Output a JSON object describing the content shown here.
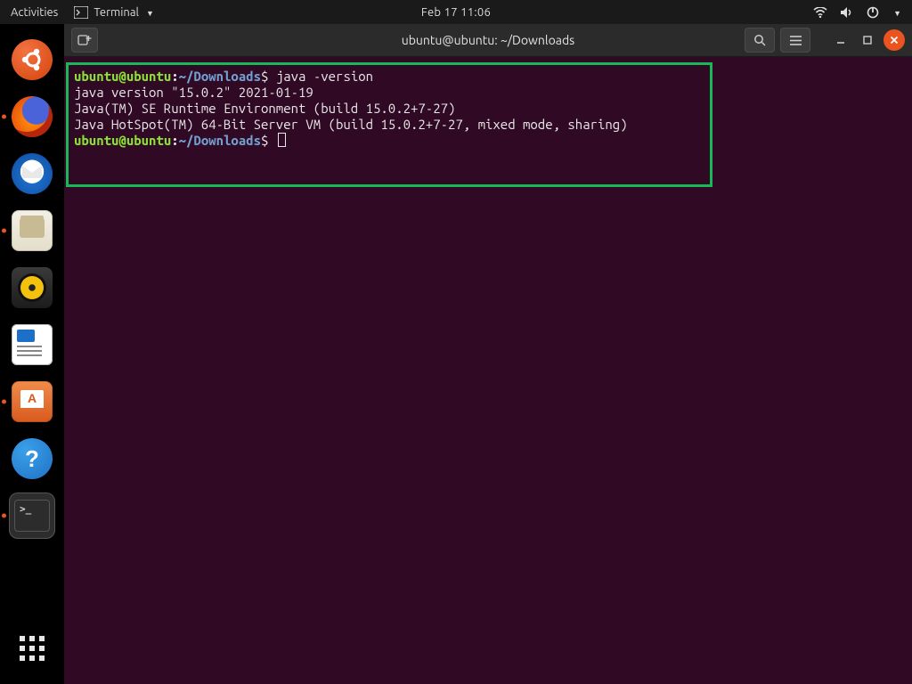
{
  "topbar": {
    "activities": "Activities",
    "app_label": "Terminal",
    "datetime": "Feb 17  11:06"
  },
  "dock": {
    "items": [
      {
        "name": "ubuntu"
      },
      {
        "name": "firefox"
      },
      {
        "name": "thunderbird"
      },
      {
        "name": "files"
      },
      {
        "name": "rhythmbox"
      },
      {
        "name": "libreoffice-writer"
      },
      {
        "name": "software"
      },
      {
        "name": "help",
        "glyph": "?"
      },
      {
        "name": "terminal"
      }
    ]
  },
  "window": {
    "title": "ubuntu@ubuntu: ~/Downloads"
  },
  "prompt": {
    "user": "ubuntu",
    "at": "@",
    "host": "ubuntu",
    "colon": ":",
    "path": "~/Downloads",
    "symbol": "$"
  },
  "terminal": {
    "cmd1": "java -version",
    "out1": "java version \"15.0.2\" 2021-01-19",
    "out2": "Java(TM) SE Runtime Environment (build 15.0.2+7-27)",
    "out3": "Java HotSpot(TM) 64-Bit Server VM (build 15.0.2+7-27, mixed mode, sharing)"
  }
}
